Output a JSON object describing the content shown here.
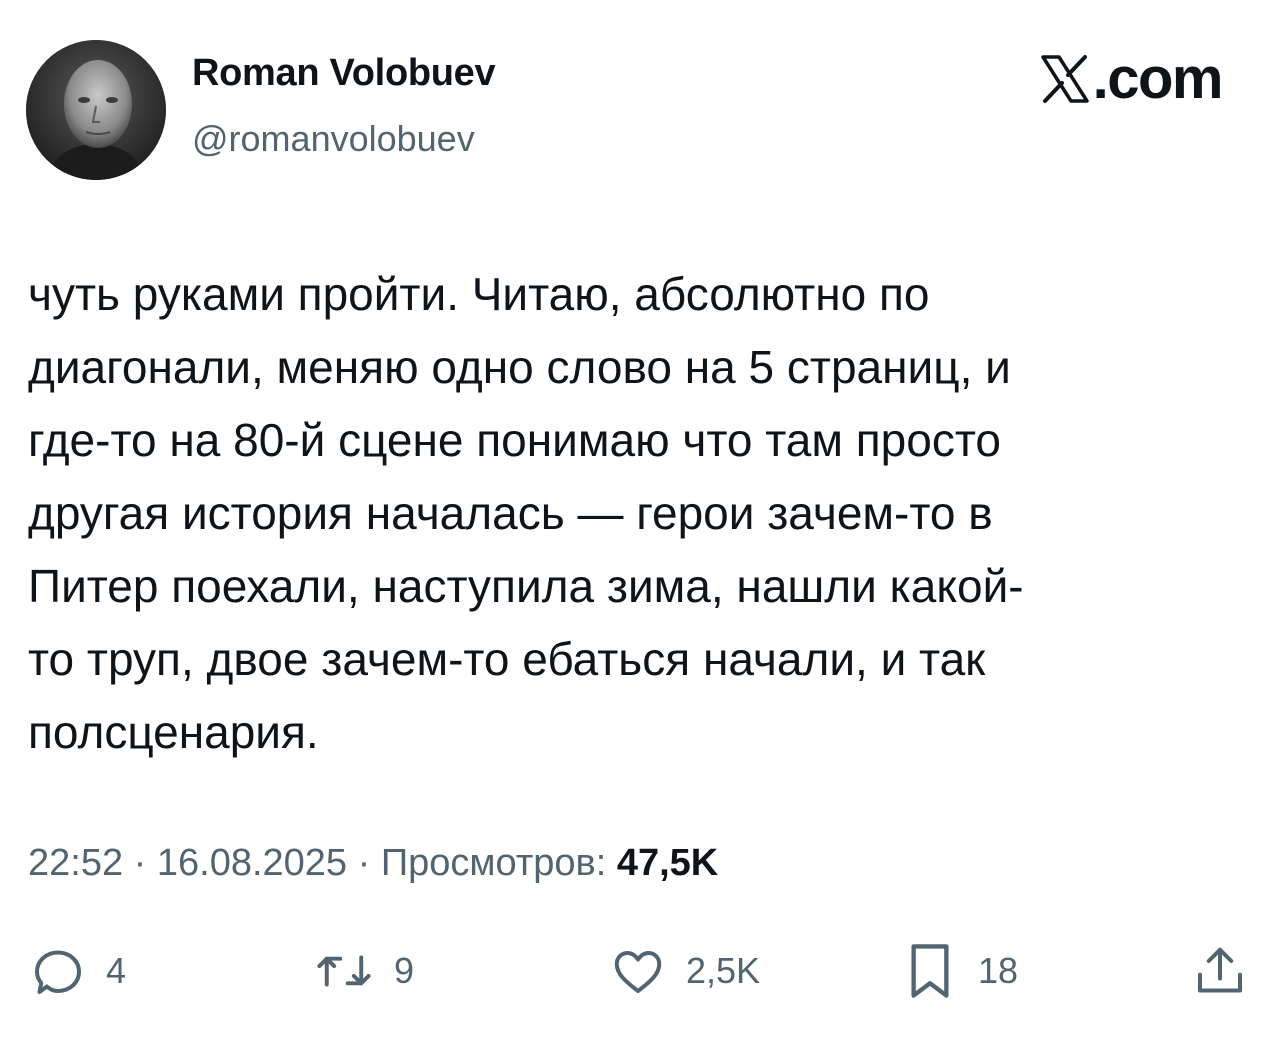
{
  "author": {
    "name": "Roman Volobuev",
    "handle": "@romanvolobuev"
  },
  "site": {
    "logo_icon": "x-logo-icon",
    "logo_suffix": ".com"
  },
  "tweet": {
    "lines": [
      "чуть руками пройти. Читаю, абсолютно по",
      "диагонали, меняю одно слово на 5 страниц, и",
      "где-то на 80-й сцене понимаю что там просто",
      "другая история началась — герои зачем-то в",
      "Питер поехали, наступила зима, нашли какой-",
      "то труп, двое зачем-то ебаться начали, и так",
      "полсценария."
    ]
  },
  "meta": {
    "time": "22:52",
    "separator": " · ",
    "date": "16.08.2025",
    "views_label": "Просмотров:",
    "views_count": "47,5K"
  },
  "actions": {
    "replies": {
      "icon": "reply-icon",
      "count": "4"
    },
    "reposts": {
      "icon": "repost-icon",
      "count": "9"
    },
    "likes": {
      "icon": "like-icon",
      "count": "2,5K"
    },
    "bookmarks": {
      "icon": "bookmark-icon",
      "count": "18"
    },
    "share": {
      "icon": "share-icon"
    }
  },
  "colors": {
    "text_primary": "#0f1419",
    "text_secondary": "#536471",
    "background": "#ffffff"
  }
}
